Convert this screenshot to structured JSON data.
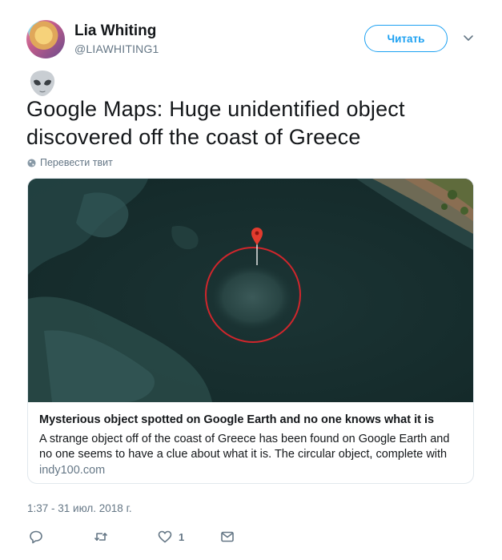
{
  "author": {
    "name": "Lia Whiting",
    "handle": "@LIAWHITING1"
  },
  "follow_button": {
    "label": "Читать"
  },
  "tweet": {
    "emoji": "alien-emoji",
    "text": "Google Maps: Huge unidentified object discovered off the coast of Greece",
    "translate_label": "Перевести твит",
    "timestamp": "1:37 - 31 июл. 2018 г."
  },
  "card": {
    "title": "Mysterious object spotted on Google Earth and no one knows what it is",
    "description": "A strange object off of the coast of Greece has been found on Google Earth and no one seems to have a clue about what it is.  The circular object, complete with smaller",
    "domain": "indy100.com"
  },
  "actions": {
    "reply": {
      "icon": "reply-icon"
    },
    "retweet": {
      "icon": "retweet-icon"
    },
    "like": {
      "icon": "heart-icon",
      "count": "1"
    },
    "message": {
      "icon": "envelope-icon"
    }
  },
  "colors": {
    "accent": "#1da1f2",
    "muted": "#657786",
    "text": "#14171a",
    "marker": "#d0262c"
  }
}
